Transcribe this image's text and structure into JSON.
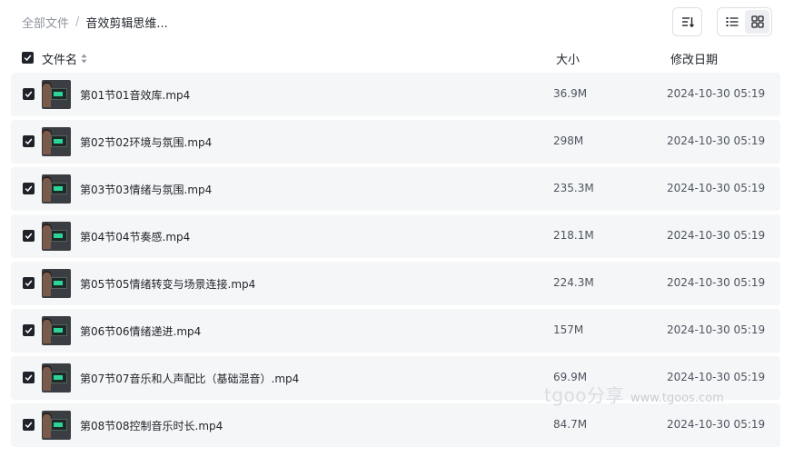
{
  "breadcrumb": {
    "root": "全部文件",
    "separator": "/",
    "current": "音效剪辑思维..."
  },
  "toolbar": {
    "sort_icon": "sort-icon",
    "list_view_icon": "list-view-icon",
    "grid_view_icon": "grid-view-icon",
    "active_view": "list"
  },
  "table": {
    "select_all_checked": true,
    "columns": {
      "name": "文件名",
      "size": "大小",
      "date": "修改日期"
    },
    "rows": [
      {
        "name": "第01节01音效库.mp4",
        "size": "36.9M",
        "date": "2024-10-30 05:19",
        "checked": true
      },
      {
        "name": "第02节02环境与氛围.mp4",
        "size": "298M",
        "date": "2024-10-30 05:19",
        "checked": true
      },
      {
        "name": "第03节03情绪与氛围.mp4",
        "size": "235.3M",
        "date": "2024-10-30 05:19",
        "checked": true
      },
      {
        "name": "第04节04节奏感.mp4",
        "size": "218.1M",
        "date": "2024-10-30 05:19",
        "checked": true
      },
      {
        "name": "第05节05情绪转变与场景连接.mp4",
        "size": "224.3M",
        "date": "2024-10-30 05:19",
        "checked": true
      },
      {
        "name": "第06节06情绪递进.mp4",
        "size": "157M",
        "date": "2024-10-30 05:19",
        "checked": true
      },
      {
        "name": "第07节07音乐和人声配比（基础混音）.mp4",
        "size": "69.9M",
        "date": "2024-10-30 05:19",
        "checked": true
      },
      {
        "name": "第08节08控制音乐时长.mp4",
        "size": "84.7M",
        "date": "2024-10-30 05:19",
        "checked": true
      }
    ]
  },
  "watermark": {
    "brand": "tgoo分享",
    "url": "www.tgoos.com"
  },
  "colors": {
    "row_background": "#f5f6f7",
    "checkbox": "#1f2329",
    "muted_text": "#8f959e"
  }
}
